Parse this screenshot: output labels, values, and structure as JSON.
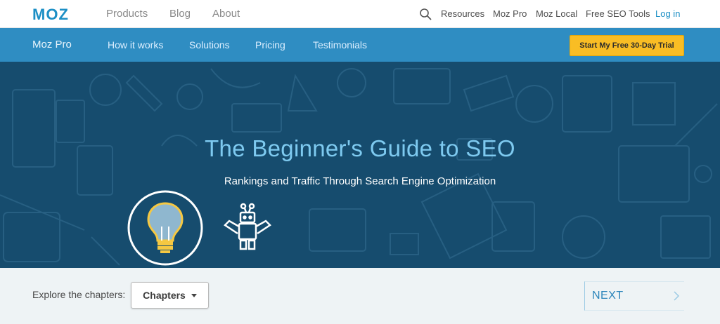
{
  "top_nav": {
    "logo_text": "MOZ",
    "links": [
      "Products",
      "Blog",
      "About"
    ],
    "right_links": [
      "Resources",
      "Moz Pro",
      "Moz Local",
      "Free SEO Tools"
    ],
    "login": "Log in",
    "search_icon": "search-icon"
  },
  "sub_nav": {
    "brand": "Moz Pro",
    "links": [
      "How it works",
      "Solutions",
      "Pricing",
      "Testimonials"
    ],
    "cta": "Start My Free 30-Day Trial"
  },
  "hero": {
    "title": "The Beginner's Guide to SEO",
    "subtitle": "Rankings and Traffic Through Search Engine Optimization",
    "icons": [
      "lightbulb-icon",
      "robot-icon"
    ]
  },
  "chapter_bar": {
    "explore_label": "Explore the chapters:",
    "dropdown_value": "Chapters",
    "next_label": "NEXT"
  },
  "colors": {
    "brand_blue": "#1c8fc5",
    "subnav_bg": "#2f8dc2",
    "hero_bg": "#164c6e",
    "hero_title": "#7ecaf0",
    "cta_bg": "#f9bd24",
    "bulb_yellow": "#f5c842"
  }
}
